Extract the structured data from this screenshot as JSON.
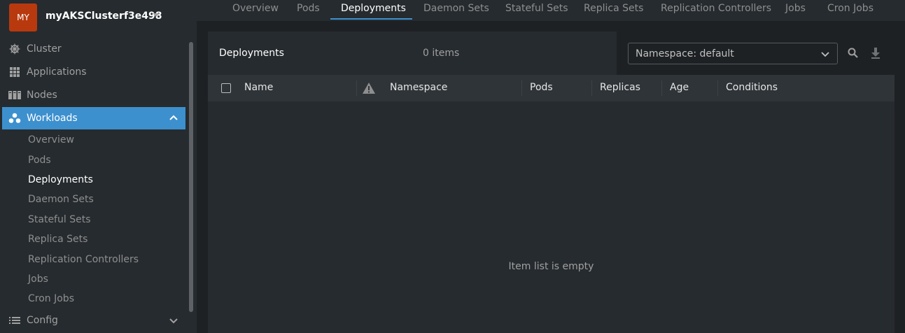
{
  "cluster": {
    "avatar": "MY",
    "name": "myAKSClusterf3e498"
  },
  "sidebar": {
    "items": [
      {
        "label": "Cluster",
        "icon": "helm-icon"
      },
      {
        "label": "Applications",
        "icon": "grid-icon"
      },
      {
        "label": "Nodes",
        "icon": "nodes-icon"
      },
      {
        "label": "Workloads",
        "icon": "workloads-icon",
        "active": true,
        "expanded": true
      },
      {
        "label": "Config",
        "icon": "list-icon"
      }
    ],
    "workloads_sub": [
      "Overview",
      "Pods",
      "Deployments",
      "Daemon Sets",
      "Stateful Sets",
      "Replica Sets",
      "Replication Controllers",
      "Jobs",
      "Cron Jobs"
    ],
    "active_sub": "Deployments"
  },
  "tabs": [
    "Overview",
    "Pods",
    "Deployments",
    "Daemon Sets",
    "Stateful Sets",
    "Replica Sets",
    "Replication Controllers",
    "Jobs",
    "Cron Jobs"
  ],
  "active_tab": "Deployments",
  "panel": {
    "title": "Deployments",
    "count": "0 items",
    "namespace_select": "Namespace: default",
    "columns": [
      "Name",
      "Namespace",
      "Pods",
      "Replicas",
      "Age",
      "Conditions"
    ],
    "empty_message": "Item list is empty"
  },
  "colors": {
    "accent": "#3d90ce",
    "avatar": "#b8390e",
    "background": "#1e2124",
    "sidebar": "#262b2f"
  }
}
